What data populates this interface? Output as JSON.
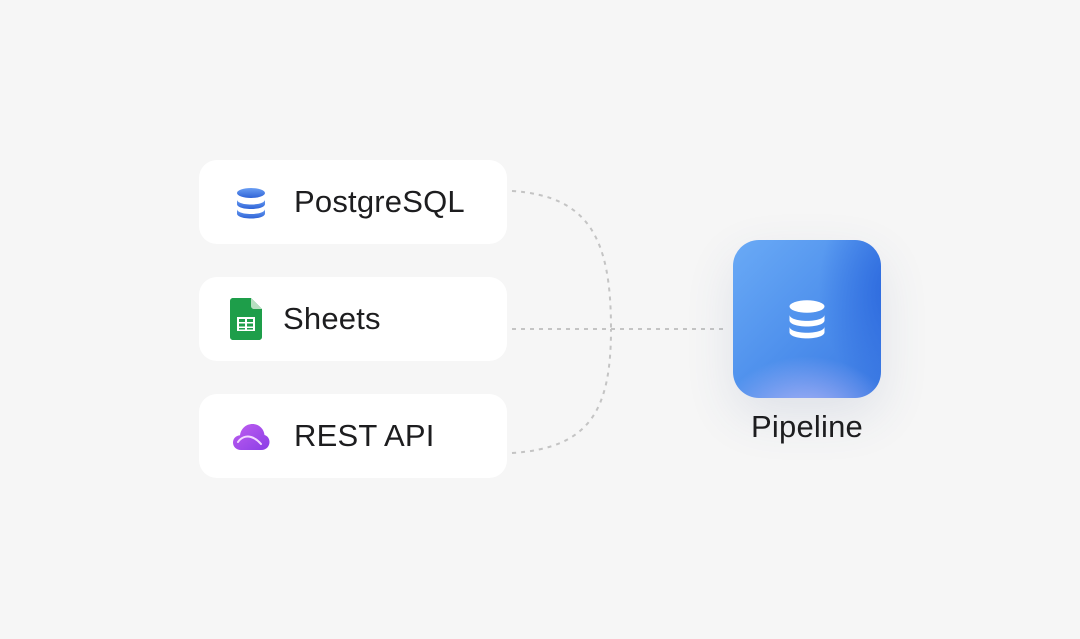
{
  "diagram": {
    "sources": [
      {
        "label": "PostgreSQL",
        "icon": "database-icon",
        "icon_color": "#3f78e0"
      },
      {
        "label": "Sheets",
        "icon": "google-sheets-icon",
        "icon_color": "#1e8e3e"
      },
      {
        "label": "REST API",
        "icon": "cloud-icon",
        "icon_color": "#9b4fe8"
      }
    ],
    "target": {
      "label": "Pipeline",
      "icon": "database-icon"
    },
    "connector_style": "dashed"
  },
  "colors": {
    "background": "#f6f6f6",
    "card": "#ffffff",
    "connector": "#c4c4c4",
    "text": "#1d1d1f"
  }
}
